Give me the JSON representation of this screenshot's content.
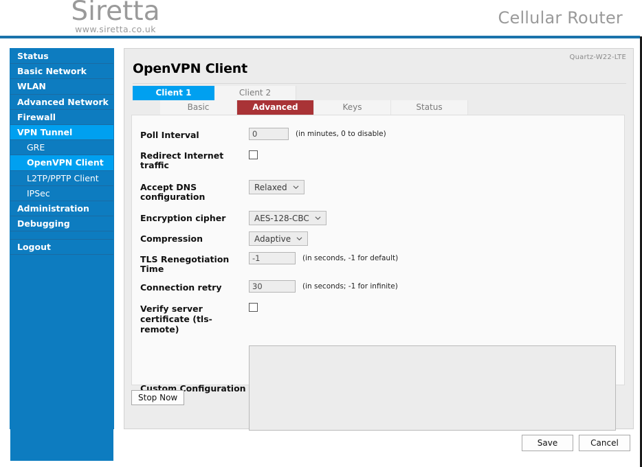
{
  "header": {
    "brand_name": "Siretta",
    "brand_url": "www.siretta.co.uk",
    "product_title": "Cellular Router"
  },
  "sidebar": {
    "items": [
      {
        "label": "Status",
        "level": "top",
        "active": false
      },
      {
        "label": "Basic Network",
        "level": "top",
        "active": false
      },
      {
        "label": "WLAN",
        "level": "top",
        "active": false
      },
      {
        "label": "Advanced Network",
        "level": "top",
        "active": false
      },
      {
        "label": "Firewall",
        "level": "top",
        "active": false
      },
      {
        "label": "VPN Tunnel",
        "level": "top",
        "active": true
      },
      {
        "label": "GRE",
        "level": "sub",
        "active": false
      },
      {
        "label": "OpenVPN Client",
        "level": "sub",
        "active": true
      },
      {
        "label": "L2TP/PPTP Client",
        "level": "sub",
        "active": false
      },
      {
        "label": "IPSec",
        "level": "sub",
        "active": false
      },
      {
        "label": "Administration",
        "level": "top",
        "active": false
      },
      {
        "label": "Debugging",
        "level": "top",
        "active": false
      }
    ],
    "logout_label": "Logout"
  },
  "content": {
    "model_label": "Quartz-W22-LTE",
    "page_title": "OpenVPN Client",
    "client_tabs": [
      {
        "label": "Client 1",
        "active": true
      },
      {
        "label": "Client 2",
        "active": false
      }
    ],
    "section_tabs": [
      {
        "label": "Basic",
        "active": false
      },
      {
        "label": "Advanced",
        "active": true
      },
      {
        "label": "Keys",
        "active": false
      },
      {
        "label": "Status",
        "active": false
      }
    ],
    "form": {
      "poll_interval": {
        "label": "Poll Interval",
        "value": "0",
        "hint": "(in minutes, 0 to disable)"
      },
      "redirect_internet_traffic": {
        "label": "Redirect Internet traffic",
        "checked": false
      },
      "accept_dns_configuration": {
        "label": "Accept DNS configuration",
        "value": "Relaxed"
      },
      "encryption_cipher": {
        "label": "Encryption cipher",
        "value": "AES-128-CBC"
      },
      "compression": {
        "label": "Compression",
        "value": "Adaptive"
      },
      "tls_renegotiation_time": {
        "label": "TLS Renegotiation Time",
        "value": "-1",
        "hint": "(in seconds, -1 for default)"
      },
      "connection_retry": {
        "label": "Connection retry",
        "value": "30",
        "hint": "(in seconds; -1 for infinite)"
      },
      "verify_server_certificate": {
        "label": "Verify server certificate (tls-remote)",
        "checked": false
      },
      "custom_configuration": {
        "label": "Custom Configuration",
        "value": ""
      }
    },
    "stop_now_label": "Stop Now"
  },
  "footer": {
    "save_label": "Save",
    "cancel_label": "Cancel"
  },
  "colors": {
    "sidebar_blue": "#0d7cc0",
    "active_blue": "#00a0f0",
    "tab_active_red": "#a93336",
    "header_rule": "#1a73ab"
  }
}
